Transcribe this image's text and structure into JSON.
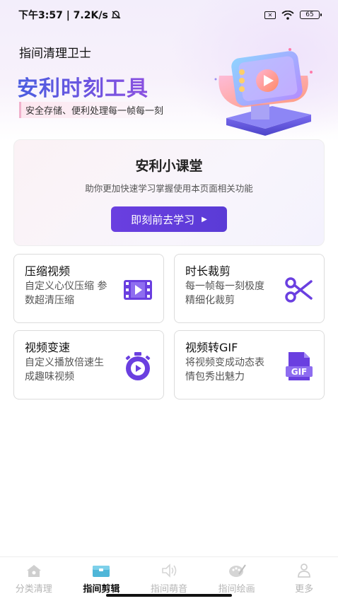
{
  "status_bar": {
    "time_speed": "下午3:57 | 7.2K/s",
    "battery": "65"
  },
  "app_title": "指间清理卫士",
  "banner": {
    "title": "安利时刻工具",
    "subtitle": "安全存储、便利处理每一帧每一刻"
  },
  "course": {
    "title": "安利小课堂",
    "desc": "助你更加快速学习掌握使用本页面相关功能",
    "button_label": "即刻前去学习"
  },
  "tools": [
    {
      "title": "压缩视频",
      "desc": "自定义心仪压缩 参数超清压缩",
      "icon": "film-icon"
    },
    {
      "title": "时长裁剪",
      "desc": "每一帧每一刻极度精细化裁剪",
      "icon": "scissors-icon"
    },
    {
      "title": "视频变速",
      "desc": "自定义播放倍速生成趣味视频",
      "icon": "stopwatch-icon"
    },
    {
      "title": "视频转GIF",
      "desc": "将视频变成动态表情包秀出魅力",
      "icon": "gif-file-icon"
    }
  ],
  "nav": [
    {
      "label": "分类清理",
      "icon": "home-icon",
      "active": false
    },
    {
      "label": "指间剪辑",
      "icon": "toolbox-icon",
      "active": true
    },
    {
      "label": "指间萌音",
      "icon": "speaker-icon",
      "active": false
    },
    {
      "label": "指间绘画",
      "icon": "palette-icon",
      "active": false
    },
    {
      "label": "更多",
      "icon": "person-icon",
      "active": false
    }
  ],
  "colors": {
    "accent": "#6a3fe0",
    "banner": "#5a4cd8"
  }
}
